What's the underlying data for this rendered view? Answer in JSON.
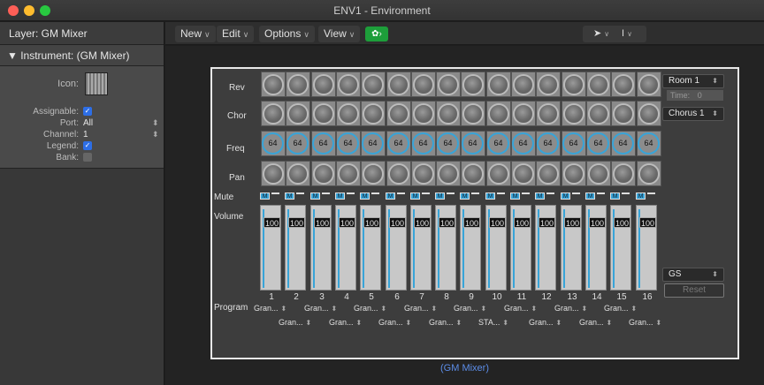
{
  "window": {
    "title": "ENV1 - Environment"
  },
  "sidebar": {
    "layer_label": "Layer: GM Mixer",
    "instrument_label": "▼ Instrument:  (GM Mixer)",
    "icon_label": "Icon:",
    "props": [
      {
        "key": "Assignable:",
        "value": "",
        "checked": true
      },
      {
        "key": "Port:",
        "value": "All",
        "stepper": true
      },
      {
        "key": "Channel:",
        "value": "1",
        "stepper": true
      },
      {
        "key": "Legend:",
        "value": "",
        "checked": true
      },
      {
        "key": "Bank:",
        "value": "",
        "checked": false
      }
    ]
  },
  "toolbar": {
    "new_label": "New",
    "edit_label": "Edit",
    "options_label": "Options",
    "view_label": "View",
    "pointer_tool": "pointer-tool-icon",
    "text_tool": "text-cursor-tool-icon"
  },
  "mixer": {
    "rows": {
      "rev": "Rev",
      "chor": "Chor",
      "freq": "Freq",
      "pan": "Pan",
      "mute": "Mute",
      "volume": "Volume",
      "program": "Program"
    },
    "channels": [
      "1",
      "2",
      "3",
      "4",
      "5",
      "6",
      "7",
      "8",
      "9",
      "10",
      "11",
      "12",
      "13",
      "14",
      "15",
      "16"
    ],
    "freq_values": [
      "64",
      "64",
      "64",
      "64",
      "64",
      "64",
      "64",
      "64",
      "64",
      "64",
      "64",
      "64",
      "64",
      "64",
      "64",
      "64"
    ],
    "mute_label": "M",
    "volume_values": [
      "100",
      "100",
      "100",
      "100",
      "100",
      "100",
      "100",
      "100",
      "100",
      "100",
      "100",
      "100",
      "100",
      "100",
      "100",
      "100"
    ],
    "programs_odd": [
      "Gran...",
      "Gran...",
      "Gran...",
      "Gran...",
      "Gran...",
      "Gran...",
      "Gran...",
      "Gran..."
    ],
    "programs_even": [
      "Gran...",
      "Gran...",
      "Gran...",
      "Gran...",
      "STA...",
      "Gran...",
      "Gran...",
      "Gran..."
    ],
    "reverb_type": "Room 1",
    "time_label": "Time:",
    "time_value": "0",
    "chorus_type": "Chorus 1",
    "mode": "GS",
    "reset_label": "Reset",
    "caption": "(GM Mixer)"
  },
  "colors": {
    "accent": "#38a4d8",
    "link": "#5c8de8",
    "palette_button": "#1d9e3a"
  }
}
